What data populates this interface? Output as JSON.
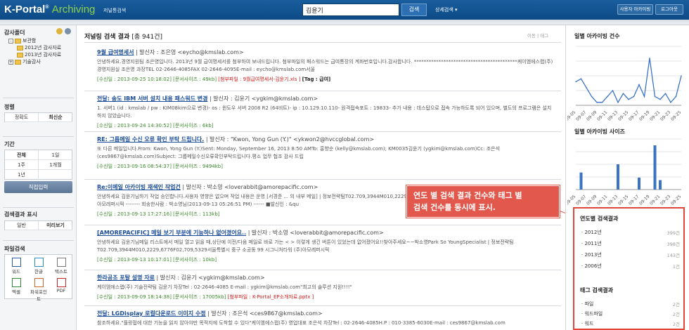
{
  "header": {
    "logo_main": "K-Portal",
    "logo_reg": "®",
    "logo_accent": "Archiving",
    "logo_sub": "저널통검색",
    "search_value": "김윤기",
    "search_btn": "검색",
    "detail_search": "상세검색 ▾",
    "user_btn": "사용자 아카이빙",
    "logout_btn": "로그아웃"
  },
  "left": {
    "folders_title": "감사폴더",
    "tree": [
      "보관함",
      "2012년 감사자료",
      "2013년 감사자료",
      "기술감사"
    ],
    "sort_title": "정렬",
    "sort": [
      "정확도",
      "최신순"
    ],
    "period_title": "기간",
    "period": [
      "전체",
      "1일",
      "1주",
      "1개월",
      "1년",
      ""
    ],
    "direct_input": "직접입력",
    "display_title": "검색결과 표시",
    "display": [
      "일반",
      "미리보기"
    ],
    "file_title": "파일검색",
    "files": [
      "워드",
      "한글",
      "텍스트",
      "엑셀",
      "파워포인트",
      "PDF"
    ]
  },
  "main": {
    "title": "저널링 검색 결과",
    "count": "[총 941건]",
    "tools": "이동 | 태그",
    "results": [
      {
        "title": "9월 급여명세서",
        "sender": "| 발신자 : 조은영 <eycho@kmslab.com>",
        "body": "안녕하세요.경영지원팀 조은영입니다. 2013년 9월 급여명세서를 첨부하여 보내드립니다. 첨부파일의 패스워드는 급여통장의 계좌번호입니다.감사합니다. ******************************************케이엠에스랩(주) 경영지원실 조은영 과장TEL 02-2646-4085FAX 02-2646-4095E-mail : eycho@kmslab.com서울",
        "date": "[수신일 : 2013-09-25 10:18:02]",
        "size": "[문서사이즈 : 49kb]",
        "attach": "[첨부파일 : 9월급여명세서-김윤기.xls ]",
        "tag": "[Tag : 급여]"
      },
      {
        "title": "전달: 송도 IBM 서버 설치 내용 패스워드 변경",
        "sender": "| 발신자 : 김윤기 <ygkim@kmslab.com>",
        "body": "1. 서버1 (id : kmslab / pw : KIM08kim으로 변경)- os : 윈도우 서버 2008 R2 (64비트)- ip : 10.129.10.110- 원격접속포트 : 19833- 추가 내용 : 데스탑으로 접속 가능하도록 되어 있으며, 별도의 프로그램은 설치 하지 않았습니다.",
        "date": "[수신일 : 2013-09-24 14:30:52]",
        "size": "[문서사이즈 : 6kb]",
        "attach": "",
        "tag": ""
      },
      {
        "title": "RE: 그룹메일 수신 오류 확인 부탁 드립니다.",
        "sender": "| 발신자 : \"Kwon, Yong Gun (Y.)\" <ykwon2@hvccglobal.com>",
        "body": "또 다른 메일입니다.From: Kwon, Yong Gun (Y.)Sent: Monday, September 16, 2013 8:50 AMTo: 홍향순 (kelly@kmslab.com); KM0035김윤기 (ygkim@kmslab.com)Cc: 조은석 (ces9867@kmslab.com)Subject: 그룹메일수신오류확인부탁드립니다.평소 업무 협조 감사 드립",
        "date": "[수신일 : 2013-09-16 08:54:37]",
        "size": "[문서사이즈 : 9494kb]",
        "attach": "",
        "tag": ""
      },
      {
        "title": "Re:이메일 아카이빙 재색인 작업건",
        "sender": "| 발신자 : 박소영 <loverabbit@amorepacific.com>",
        "body": "안녕하세요 김윤기님하기 작업 승인합니다.사용자 영향은 없으며 작업 내용은 운영 [서경준 ... 의 내부 메일] | 정보전략팀T02.709,3944M010,2229,6776F02,709,5329서울특별시 중구 소공동 99 시그니처타워 (주)아모레퍼시픽 -------- 회송한사람 : 박소영님(2013-09-13 05:26:51 PM) ------ ■발신인 : &qu",
        "date": "[수신일 : 2013-09-13 17:27:16]",
        "size": "[문서사이즈 : 113kb]",
        "attach": "",
        "tag": ""
      },
      {
        "title": "[AMOREPACIFIC] 메일 보기 부분에 기능하나 없어졌어요..",
        "sender": "| 발신자 : 박소영 <loverabbit@amorepacific.com>",
        "body": "안녕하세요 김윤기님메일 리스트에서 메일 열고 읽을 때,상단에 이전/다음 메일로 바로 가는 < > 이렇게 생긴 버튼이 있었는데 없어졌어요!!찾아주세요~~박소영Park So YoungSpecialist | 정보전략팀T02.709,3944M010,2229,6776F02,709,5329서울특별시 중구 소공동 99 시그니처타워 (주)아모레퍼시픽",
        "date": "[수신일 : 2013-09-13 10:17:01]",
        "size": "[문서사이즈 : 10kb]",
        "attach": "",
        "tag": ""
      },
      {
        "title": "한라공조 포탈 설명 자료",
        "sender": "| 발신자 : 김윤기 <ygkim@kmslab.com>",
        "body": "케이엠에스랩(주) 기술전략팀 김윤기 차장Tel : 02-2646-4085 E-mail : ygkim@kmslab.com\"최고의 솔루션 지원!!!!\"",
        "date": "[수신일 : 2013-09-09 18:14:38]",
        "size": "[문서사이즈 : 17005kb]",
        "attach": "[첨부파일 : K-Portal_EP소개자료.pptx ]",
        "tag": ""
      },
      {
        "title": "전달: LGDisplay 로컬다운로드 이미지 수정",
        "sender": "| 발신자 : 조은석 <ces9867@kmslab.com>",
        "body": "참조하세요.\"플랑접에 대한 기능을 읽지 않아야만 목적지에 도착할 수 있다\"케이엠에스랩(주) 영업대표 조은석 차장Tel : 02-2646-4085H.P : 010-3385-6030E-mail : ces9867@kmslab.com",
        "date": "",
        "size": "",
        "attach": "",
        "tag": ""
      }
    ]
  },
  "callout": {
    "line1": "연도 별 검색 결과 건수와 태그 별",
    "line2": "검색 건수를 동시에 표시."
  },
  "right": {
    "daily_title": "일별 아카이빙 건수",
    "size_title": "일별 아카이빙 사이즈",
    "year_title": "연도별 검색결과",
    "years": [
      {
        "label": "2012년",
        "count": "399건"
      },
      {
        "label": "2011년",
        "count": "398건"
      },
      {
        "label": "2013년",
        "count": "143건"
      },
      {
        "label": "2006년",
        "count": "1건"
      }
    ],
    "tag_title": "태그 검색결과",
    "tags": [
      {
        "label": "파일",
        "count": "2건"
      },
      {
        "label": "워드파일",
        "count": "2건"
      },
      {
        "label": "워드",
        "count": "2건"
      }
    ]
  },
  "chart_data": [
    {
      "type": "line",
      "title": "일별 아카이빙 건수",
      "categories": [
        "09-05",
        "09-07",
        "09-09",
        "09-11",
        "09-13",
        "09-15",
        "09-17",
        "09-19",
        "09-21",
        "09-23",
        "09-25"
      ],
      "x": [
        "09-05",
        "09-06",
        "09-07",
        "09-08",
        "09-09",
        "09-10",
        "09-11",
        "09-12",
        "09-13",
        "09-14",
        "09-15",
        "09-16",
        "09-17",
        "09-18",
        "09-19",
        "09-20",
        "09-21",
        "09-22",
        "09-23",
        "09-24",
        "09-25"
      ],
      "values": [
        8,
        9,
        6,
        3,
        1,
        1,
        3,
        5,
        1,
        4,
        2,
        3,
        7,
        3,
        16,
        3,
        2,
        4,
        1,
        3,
        10
      ],
      "ylim": [
        0,
        20
      ],
      "color": "#3b73c5",
      "grid": true
    },
    {
      "type": "bar",
      "title": "일별 아카이빙 사이즈",
      "x": [
        "09-05",
        "09-06",
        "09-07",
        "09-08",
        "09-09",
        "09-10",
        "09-11",
        "09-12",
        "09-13",
        "09-14",
        "09-15",
        "09-16",
        "09-17",
        "09-18",
        "09-19",
        "09-20",
        "09-21",
        "09-22",
        "09-23",
        "09-24",
        "09-25"
      ],
      "categories": [
        "09-05",
        "09-07",
        "09-09",
        "09-11",
        "09-13",
        "09-15",
        "09-17",
        "09-19",
        "09-21",
        "09-23",
        "09-25"
      ],
      "values": [
        0,
        13500,
        0,
        0,
        0,
        0,
        0,
        0,
        20000,
        0,
        0,
        0,
        9500,
        0,
        0,
        35000,
        7500,
        0,
        0,
        0,
        0
      ],
      "ylim": [
        0,
        40000
      ],
      "color": "#3b73c5",
      "grid": true
    }
  ]
}
